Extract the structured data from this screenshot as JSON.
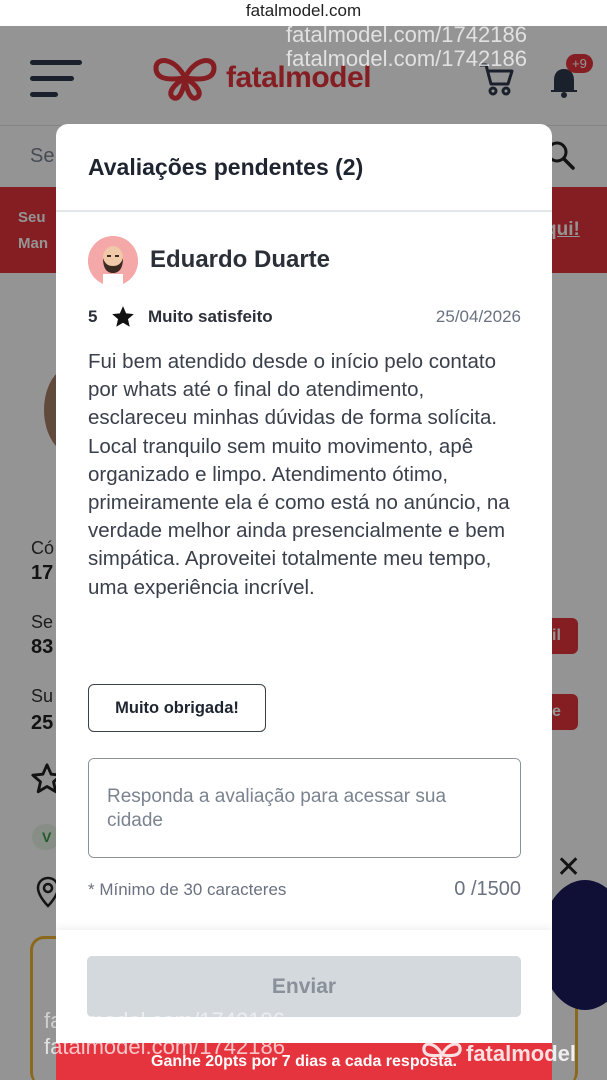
{
  "browser": {
    "url": "fatalmodel.com"
  },
  "header": {
    "brand": "fatalmodel",
    "notification_count": "+9"
  },
  "search": {
    "placeholder": "Se"
  },
  "banner": {
    "line1": "Seu",
    "line2": "Man",
    "link": "qui!"
  },
  "background": {
    "labels": [
      "Có",
      "Se",
      "Su"
    ],
    "values": [
      "17",
      "83",
      "25"
    ],
    "btn1": "il",
    "btn2": "e",
    "chip": "V"
  },
  "modal": {
    "title": "Avaliações pendentes (2)",
    "review": {
      "reviewer_name": "Eduardo Duarte",
      "rating": "5",
      "rating_label": "Muito satisfeito",
      "date": "25/04/2026",
      "text": "Fui bem atendido desde o início pelo contato por whats até o final do atendimento, esclareceu minhas dúvidas de forma solícita. Local tranquilo sem muito movimento, apê organizado e limpo. Atendimento ótimo, primeiramente ela é como está no anúncio, na verdade melhor ainda presencialmente e bem simpática. Aproveitei totalmente meu tempo, uma experiência incrível."
    },
    "quick_reply_label": "Muito obrigada!",
    "reply_placeholder": "Responda a avaliação para acessar sua cidade",
    "min_chars_hint": "* Mínimo de 30 caracteres",
    "char_count": "0 /1500",
    "send_label": "Enviar"
  },
  "bottom_banner": {
    "text": "Ganhe 20pts por 7 dias a cada resposta."
  },
  "watermarks": {
    "w1": "fatalmodel.com/1742186",
    "w2": "fatalmodel.com/1742186",
    "w3": "fatalmodel.com/1742186",
    "w4": "fatalmodel.com/1742186",
    "logo": "fatalmodel"
  },
  "colors": {
    "brand_red": "#e5343d",
    "navy": "#2f3a4d",
    "disabled_btn": "#d4d9de"
  }
}
